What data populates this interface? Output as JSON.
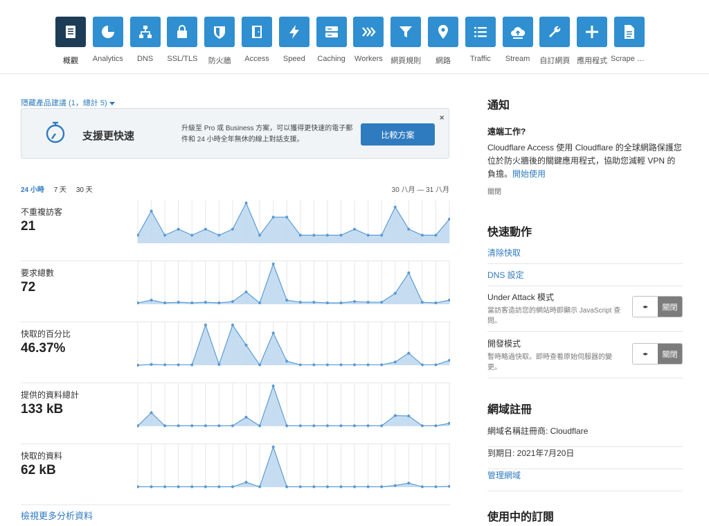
{
  "nav": [
    {
      "label": "概觀",
      "icon": "overview-icon",
      "active": true
    },
    {
      "label": "Analytics",
      "icon": "analytics-icon"
    },
    {
      "label": "DNS",
      "icon": "dns-icon"
    },
    {
      "label": "SSL/TLS",
      "icon": "lock-icon"
    },
    {
      "label": "防火牆",
      "icon": "shield-icon"
    },
    {
      "label": "Access",
      "icon": "door-icon"
    },
    {
      "label": "Speed",
      "icon": "lightning-icon"
    },
    {
      "label": "Caching",
      "icon": "server-icon"
    },
    {
      "label": "Workers",
      "icon": "workers-icon"
    },
    {
      "label": "網頁規則",
      "icon": "filter-icon"
    },
    {
      "label": "網路",
      "icon": "location-pin-icon"
    },
    {
      "label": "Traffic",
      "icon": "list-icon"
    },
    {
      "label": "Stream",
      "icon": "cloud-upload-icon"
    },
    {
      "label": "自訂網頁",
      "icon": "wrench-icon"
    },
    {
      "label": "應用程式",
      "icon": "plus-icon"
    },
    {
      "label": "Scrape S…",
      "icon": "document-icon"
    }
  ],
  "suggestions": {
    "toggle_label": "隱藏產品建議 (1，總計 5)",
    "promo_title": "支援更快速",
    "promo_text": "升級至 Pro 或 Business 方案，可以獲得更快速的電子郵件和 24 小時全年無休的線上對話支援。",
    "promo_button": "比較方案",
    "close": "×",
    "icon": "stopwatch-icon"
  },
  "analytics": {
    "ranges": [
      "24 小時",
      "7 天",
      "30 天"
    ],
    "active_range": 0,
    "date_range": "30 八月 — 31 八月",
    "more_link": "檢視更多分析資料",
    "accent_color": "#5b9bd5",
    "fill_color": "#bcd7ee",
    "metrics": [
      {
        "label": "不重複訪客",
        "value": "21",
        "points": [
          2,
          8,
          2,
          3.5,
          2,
          3.5,
          2,
          3.5,
          10,
          2,
          6.5,
          6.5,
          2,
          2,
          2,
          2,
          3.5,
          2,
          2,
          9,
          3.5,
          2,
          2,
          6
        ]
      },
      {
        "label": "要求總數",
        "value": "72",
        "points": [
          2,
          6,
          2,
          3,
          2,
          3,
          2,
          4,
          18,
          2,
          59,
          6,
          3,
          3,
          2,
          2,
          4,
          3,
          3,
          16,
          46,
          3,
          2,
          6
        ]
      },
      {
        "label": "快取的百分比",
        "value": "46.37%",
        "points": [
          0,
          2,
          1,
          1,
          1,
          100,
          2,
          100,
          50,
          1,
          80,
          10,
          1,
          1,
          1,
          1,
          1,
          1,
          1,
          8,
          30,
          1,
          1,
          12
        ]
      },
      {
        "label": "提供的資料總計",
        "value": "133 kB",
        "points": [
          1,
          33,
          1,
          1,
          1,
          1,
          1,
          1,
          22,
          1,
          98,
          1,
          1,
          1,
          1,
          1,
          1,
          1,
          1,
          26,
          25,
          1,
          1,
          7
        ]
      },
      {
        "label": "快取的資料",
        "value": "62 kB",
        "points": [
          1,
          1,
          1,
          1,
          1,
          1,
          1,
          1,
          12,
          1,
          98,
          1,
          1,
          1,
          1,
          1,
          1,
          1,
          1,
          4,
          10,
          1,
          1,
          2
        ]
      }
    ]
  },
  "notice": {
    "title": "通知",
    "subtitle": "遠端工作?",
    "body": "Cloudflare Access 使用 Cloudflare 的全球網路保護您位於防火牆後的關鍵應用程式，協助您減輕 VPN 的負擔。",
    "link": "開始使用",
    "close": "關閉"
  },
  "quick_actions": {
    "title": "快速動作",
    "purge_cache": "清除快取",
    "dns_settings": "DNS 設定",
    "under_attack": {
      "title": "Under Attack 模式",
      "desc": "當訪客造訪您的網站時即顯示 JavaScript 查問。",
      "state": "關閉",
      "knob": "◂▸"
    },
    "dev_mode": {
      "title": "開發模式",
      "desc": "暫時略過快取。即時查看原始伺服器的變更。",
      "state": "關閉",
      "knob": "◂▸"
    }
  },
  "registration": {
    "title": "網域註冊",
    "registrar": "網域名稱註冊商: Cloudflare",
    "expires": "到期日: 2021年7月20日",
    "manage": "管理網域"
  },
  "subscriptions": {
    "title": "使用中的訂閱"
  }
}
